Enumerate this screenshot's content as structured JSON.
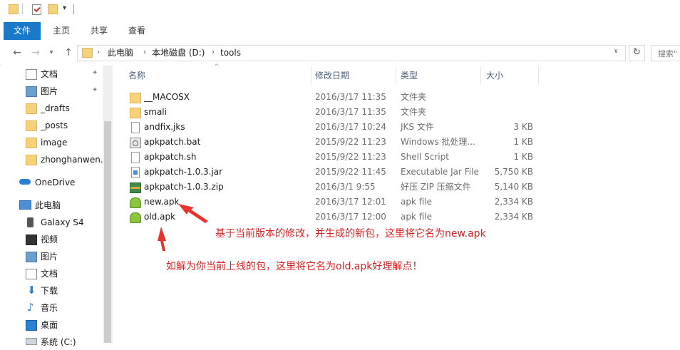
{
  "ribbon": {
    "tabs": [
      "文件",
      "主页",
      "共享",
      "查看"
    ]
  },
  "address": {
    "crumbs": [
      "此电脑",
      "本地磁盘 (D:)",
      "tools"
    ],
    "search_placeholder": "搜索\""
  },
  "sidebar": {
    "quick_access": [
      {
        "label": "文档",
        "icon": "document-icon",
        "pinned": true
      },
      {
        "label": "图片",
        "icon": "pictures-icon",
        "pinned": true
      },
      {
        "label": "_drafts",
        "icon": "folder-icon",
        "pinned": false
      },
      {
        "label": "_posts",
        "icon": "folder-icon",
        "pinned": false
      },
      {
        "label": "image",
        "icon": "folder-icon",
        "pinned": false
      },
      {
        "label": "zhonghanwen.g",
        "icon": "folder-icon",
        "pinned": false
      }
    ],
    "onedrive": "OneDrive",
    "this_pc": "此电脑",
    "pc_items": [
      {
        "label": "Galaxy S4",
        "icon": "phone-icon"
      },
      {
        "label": "视频",
        "icon": "video-icon"
      },
      {
        "label": "图片",
        "icon": "pictures-icon"
      },
      {
        "label": "文档",
        "icon": "document-icon"
      },
      {
        "label": "下载",
        "icon": "download-icon"
      },
      {
        "label": "音乐",
        "icon": "music-icon"
      },
      {
        "label": "桌面",
        "icon": "desktop-icon"
      },
      {
        "label": "系统 (C:)",
        "icon": "drive-icon"
      }
    ]
  },
  "columns": {
    "name": "名称",
    "date": "修改日期",
    "type": "类型",
    "size": "大小"
  },
  "files": [
    {
      "name": "__MACOSX",
      "date": "2016/3/17 11:35",
      "type": "文件夹",
      "size": "",
      "icon": "folder-icon"
    },
    {
      "name": "smali",
      "date": "2016/3/17 11:35",
      "type": "文件夹",
      "size": "",
      "icon": "folder-icon"
    },
    {
      "name": "andfix.jks",
      "date": "2016/3/17 10:24",
      "type": "JKS 文件",
      "size": "3 KB",
      "icon": "file-icon"
    },
    {
      "name": "apkpatch.bat",
      "date": "2015/9/22 11:23",
      "type": "Windows 批处理...",
      "size": "1 KB",
      "icon": "batch-file-icon"
    },
    {
      "name": "apkpatch.sh",
      "date": "2015/9/22 11:23",
      "type": "Shell Script",
      "size": "1 KB",
      "icon": "file-icon"
    },
    {
      "name": "apkpatch-1.0.3.jar",
      "date": "2015/9/22 11:45",
      "type": "Executable Jar File",
      "size": "5,750 KB",
      "icon": "jar-icon"
    },
    {
      "name": "apkpatch-1.0.3.zip",
      "date": "2016/3/1 9:55",
      "type": "好压 ZIP 压缩文件",
      "size": "5,140 KB",
      "icon": "zip-icon"
    },
    {
      "name": "new.apk",
      "date": "2016/3/17 12:01",
      "type": "apk file",
      "size": "2,334 KB",
      "icon": "apk-icon"
    },
    {
      "name": "old.apk",
      "date": "2016/3/17 12:00",
      "type": "apk file",
      "size": "2,334 KB",
      "icon": "apk-icon"
    }
  ],
  "annotations": {
    "new_apk": "基于当前版本的修改，并生成的新包，这里将它名为new.apk",
    "old_apk": "如解为你当前上线的包，这里将它名为old.apk好理解点！"
  },
  "colors": {
    "accent": "#1979ca",
    "annotation": "#e02020"
  }
}
